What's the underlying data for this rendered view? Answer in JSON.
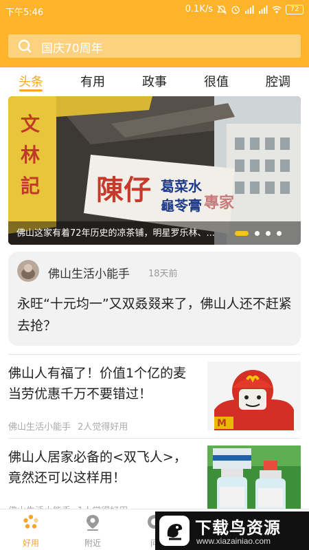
{
  "status_bar": {
    "time": "下午5:46",
    "network_speed": "0.1K/s",
    "battery": "72"
  },
  "search": {
    "placeholder": "国庆70周年"
  },
  "tabs": [
    {
      "label": "头条",
      "active": true
    },
    {
      "label": "有用",
      "active": false
    },
    {
      "label": "政事",
      "active": false
    },
    {
      "label": "很值",
      "active": false
    },
    {
      "label": "腔调",
      "active": false
    }
  ],
  "banner": {
    "caption": "佛山这家有着72年历史的凉茶铺，明星罗乐林、...",
    "sign_main": "陳仔",
    "sign_sub1": "葛菜水",
    "sign_sub2": "龜苓膏",
    "sign_sub3": "專家",
    "slide_count": 4,
    "active_slide": 1
  },
  "post": {
    "author": "佛山生活小能手",
    "time": "18天前",
    "text": "永旺“十元均一”又双叒叕来了，佛山人还不赶紧去抢？"
  },
  "articles": [
    {
      "title": "佛山人有福了！价值1个亿的麦当劳优惠千万不要错过！",
      "source": "佛山生活小能手",
      "likes": "2人觉得好用"
    },
    {
      "title": "佛山人居家必备的<双飞人>，竟然还可以这样用！",
      "source": "佛山生活小能手",
      "likes": "1人觉得好用"
    }
  ],
  "bottom_nav": [
    {
      "label": "好用",
      "icon": "flower-icon",
      "active": true
    },
    {
      "label": "附近",
      "icon": "location-icon",
      "active": false
    },
    {
      "label": "问",
      "icon": "question-icon",
      "active": false
    }
  ],
  "watermark": {
    "title": "下载鸟资源",
    "url": "www.xiazainiao.com"
  },
  "colors": {
    "brand": "#fdb32a",
    "accent": "#f5a623",
    "dot_active": "#f5c518"
  }
}
